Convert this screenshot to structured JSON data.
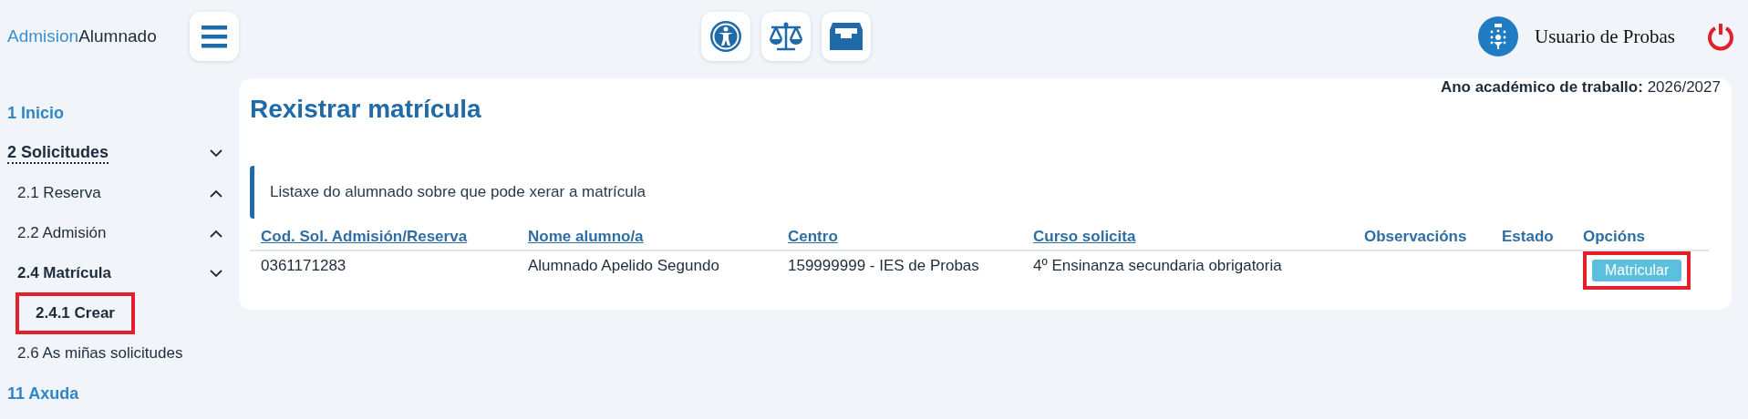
{
  "brand": {
    "part_1": "Admision",
    "part_2": "Alumnado"
  },
  "user": {
    "name": "Usuario de Probas"
  },
  "sidebar": {
    "items": [
      {
        "label": "1 Inicio",
        "active": false
      },
      {
        "label": "2 Solicitudes",
        "active": true,
        "expanded": true,
        "children": [
          {
            "label": "2.1 Reserva",
            "active": false,
            "expanded": false
          },
          {
            "label": "2.2 Admisión",
            "active": false,
            "expanded": false
          },
          {
            "label": "2.4 Matrícula",
            "active": true,
            "expanded": true,
            "children": [
              {
                "label": "2.4.1 Crear",
                "active": true,
                "highlighted": true
              }
            ]
          },
          {
            "label": "2.6 As miñas solicitudes",
            "active": false
          }
        ]
      },
      {
        "label": "11 Axuda",
        "active": false
      }
    ]
  },
  "page": {
    "title": "Rexistrar matrícula",
    "year_label": "Ano académico de traballo:",
    "year_value": "2026/2027",
    "notice": "Listaxe do alumnado sobre que pode xerar a matrícula"
  },
  "table": {
    "columns": [
      {
        "label": "Cod. Sol. Admisión/Reserva",
        "sortable": true
      },
      {
        "label": "Nome alumno/a",
        "sortable": true
      },
      {
        "label": "Centro",
        "sortable": true
      },
      {
        "label": "Curso solicita",
        "sortable": true
      },
      {
        "label": "Observacións",
        "sortable": false
      },
      {
        "label": "Estado",
        "sortable": false
      },
      {
        "label": "Opcións",
        "sortable": false
      }
    ],
    "rows": [
      {
        "cells": [
          "0361171283",
          "Alumnado Apelido Segundo",
          "159999999 - IES de Probas",
          "4º Ensinanza secundaria obrigatoria",
          "",
          ""
        ],
        "action": {
          "label": "Matricular",
          "highlighted": true
        }
      }
    ]
  }
}
